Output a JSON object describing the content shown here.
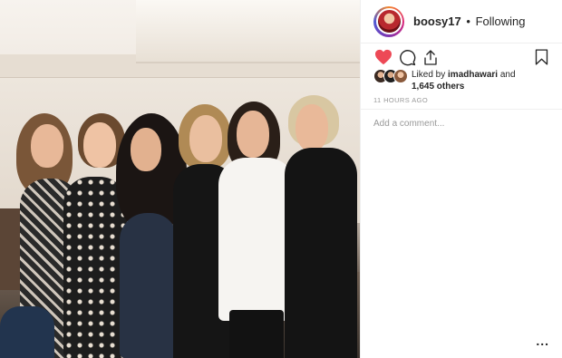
{
  "header": {
    "username": "boosy17",
    "separator": "•",
    "follow_status": "Following"
  },
  "actions": {
    "like_icon": "heart-filled-icon",
    "comment_icon": "comment-icon",
    "share_icon": "share-icon",
    "save_icon": "bookmark-icon",
    "like_color": "#ed4956"
  },
  "likes": {
    "prefix": "Liked by ",
    "liker": "imadhawari",
    "middle": " and",
    "count": "1,645 others"
  },
  "timestamp": "11 HOURS AGO",
  "comment_box": {
    "placeholder": "Add a comment..."
  },
  "more_menu": "..."
}
